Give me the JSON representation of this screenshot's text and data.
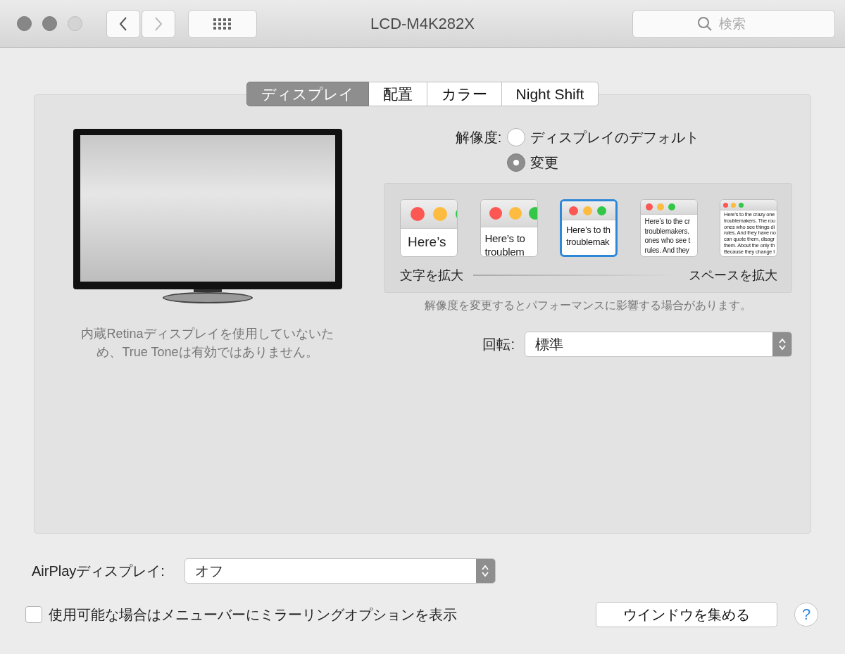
{
  "window": {
    "title": "LCD-M4K282X",
    "search": {
      "placeholder": "検索"
    }
  },
  "tabs": [
    {
      "label": "ディスプレイ",
      "selected": true
    },
    {
      "label": "配置",
      "selected": false
    },
    {
      "label": "カラー",
      "selected": false
    },
    {
      "label": "Night Shift",
      "selected": false
    }
  ],
  "display_caption": "内蔵Retinaディスプレイを使用していないため、True Toneは有効ではありません。",
  "resolution": {
    "label": "解像度:",
    "options": [
      {
        "label": "ディスプレイのデフォルト",
        "selected": false
      },
      {
        "label": "変更",
        "selected": true
      }
    ],
    "scaled": [
      {
        "lines": [
          "Here’s"
        ],
        "selected": false,
        "kind": "xl"
      },
      {
        "lines": [
          "Here’s to",
          "troublem"
        ],
        "selected": false,
        "kind": "l"
      },
      {
        "lines": [
          "Here’s to th",
          "troublemak"
        ],
        "selected": true,
        "kind": "m"
      },
      {
        "lines": [
          "Here’s to the cr",
          "troublemakers.",
          "ones who see t",
          "rules. And they"
        ],
        "selected": false,
        "kind": "s"
      },
      {
        "lines": [
          "Here's to the crazy one",
          "troublemakers. The rou",
          "ones who see things di",
          "rules. And they have no",
          "can quote them, disagr",
          "them. About the only th",
          "Because they change t"
        ],
        "selected": false,
        "kind": "xs"
      }
    ],
    "left_label": "文字を拡大",
    "right_label": "スペースを拡大",
    "note": "解像度を変更するとパフォーマンスに影響する場合があります。"
  },
  "rotation": {
    "label": "回転:",
    "value": "標準"
  },
  "airplay": {
    "label": "AirPlayディスプレイ:",
    "value": "オフ"
  },
  "mirroring_option": {
    "label": "使用可能な場合はメニューバーにミラーリングオプションを表示",
    "checked": false
  },
  "gather_button": "ウインドウを集める",
  "help": "?"
}
